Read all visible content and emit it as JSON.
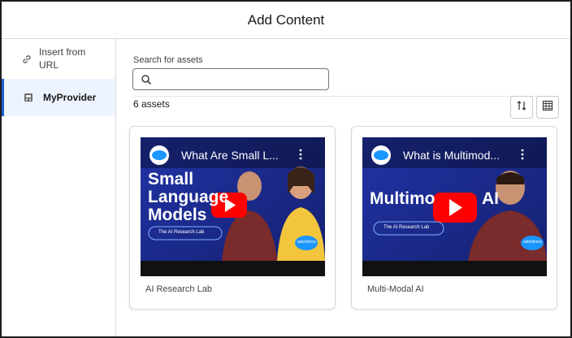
{
  "dialog": {
    "title": "Add Content"
  },
  "sidebar": {
    "items": [
      {
        "label": "Insert from URL",
        "icon": "link-icon"
      },
      {
        "label": "MyProvider",
        "icon": "provider-icon",
        "selected": true
      }
    ]
  },
  "search": {
    "label": "Search for assets",
    "value": "",
    "placeholder": ""
  },
  "results": {
    "count_label": "6 assets"
  },
  "toolbar": {
    "sort_icon": "sort-icon",
    "view_icon": "grid-view-icon"
  },
  "cards": [
    {
      "title": "AI Research Lab",
      "video_title": "What Are Small L...",
      "overlay_lines": [
        "Small",
        "Language",
        "Models"
      ],
      "badge": "The AI Research Lab",
      "logo": "salesforce"
    },
    {
      "title": "Multi-Modal AI",
      "video_title": "What is Multimod...",
      "overlay_lines": [
        "Multimo",
        "AI"
      ],
      "badge": "The AI Research Lab",
      "logo": "salesforce"
    }
  ],
  "colors": {
    "accent": "#1b5fd1",
    "selected_bg": "#eef4ff",
    "youtube_red": "#ff0000",
    "thumb_bg": "#1d2a8a"
  }
}
